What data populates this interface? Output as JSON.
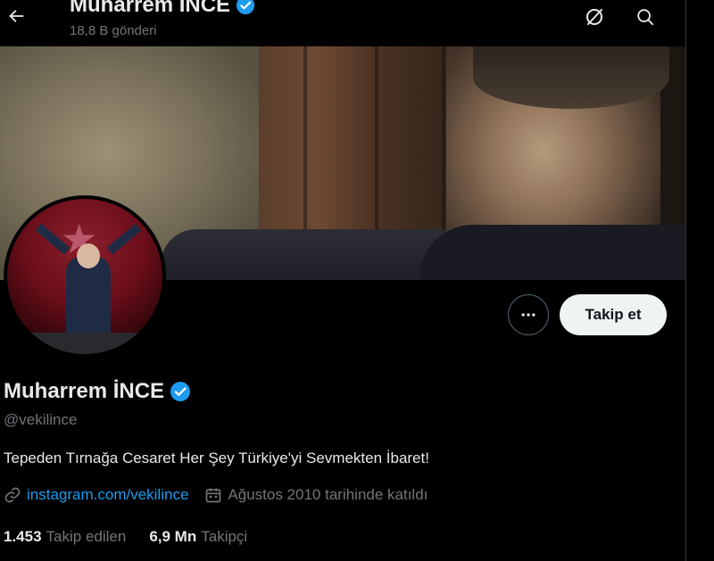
{
  "header": {
    "title": "Muharrem İNCE",
    "post_count": "18,8 B gönderi",
    "back_icon": "arrow-left-icon",
    "grok_icon": "grok-icon",
    "search_icon": "search-icon"
  },
  "profile": {
    "name": "Muharrem İNCE",
    "handle": "@vekilince",
    "bio": "Tepeden Tırnağa Cesaret Her Şey Türkiye'yi Sevmekten İbaret!",
    "link": "instagram.com/vekilince",
    "joined": "Ağustos 2010 tarihinde katıldı",
    "verified_color": "#1d9bf0"
  },
  "actions": {
    "follow_label": "Takip et",
    "more_icon": "more-dots-icon"
  },
  "stats": {
    "following_count": "1.453",
    "following_label": "Takip edilen",
    "followers_count": "6,9 Mn",
    "followers_label": "Takipçi"
  }
}
